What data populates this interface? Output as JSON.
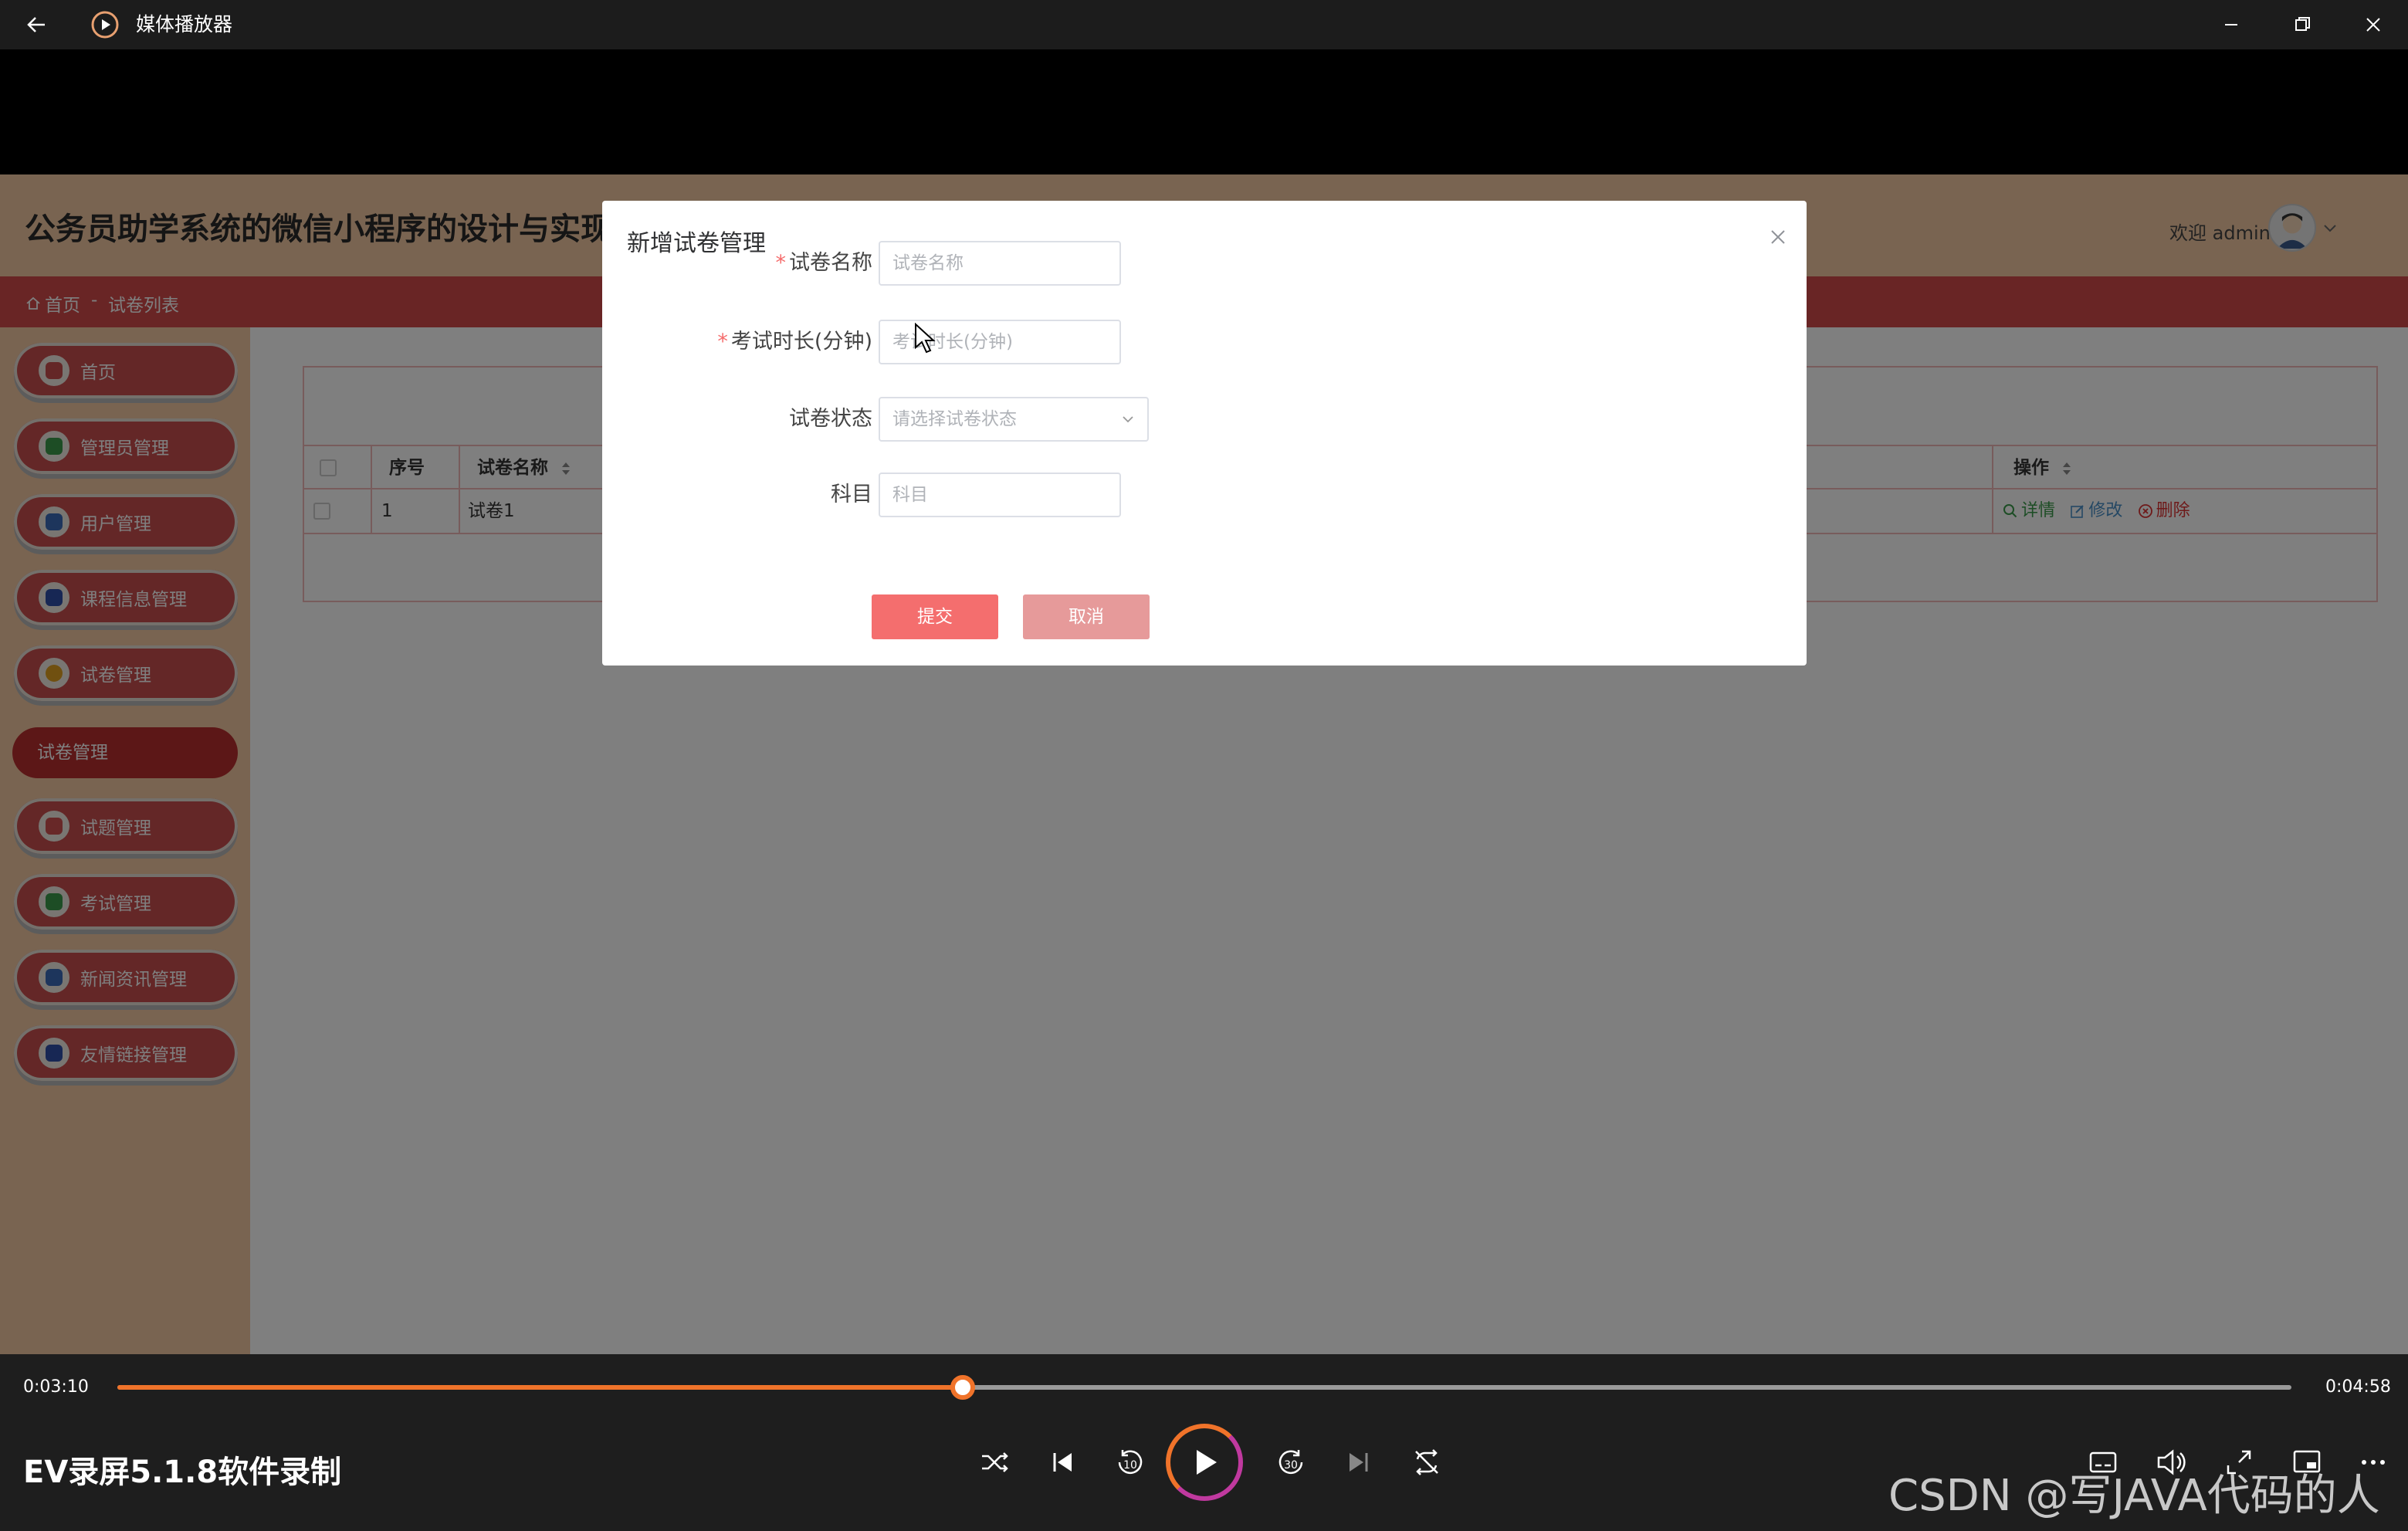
{
  "player": {
    "title": "媒体播放器",
    "time_current": "0:03:10",
    "time_total": "0:04:58",
    "progress": 0.389,
    "track_text": "EV录屏5.1.8软件录制",
    "watermark": "CSDN @写JAVA代码的人",
    "accent_color": "#f0732a"
  },
  "header": {
    "system_title": "公务员助学系统的微信小程序的设计与实现",
    "welcome": "欢迎 admin"
  },
  "breadcrumb": {
    "home": "首页",
    "separator": "-",
    "current": "试卷列表"
  },
  "sidebar": {
    "items": [
      {
        "label": "首页",
        "icon": "home-icon"
      },
      {
        "label": "管理员管理",
        "icon": "admin-icon"
      },
      {
        "label": "用户管理",
        "icon": "user-icon"
      },
      {
        "label": "课程信息管理",
        "icon": "course-icon"
      },
      {
        "label": "试卷管理",
        "icon": "paper-icon"
      },
      {
        "label": "试题管理",
        "icon": "question-icon"
      },
      {
        "label": "考试管理",
        "icon": "exam-icon"
      },
      {
        "label": "新闻资讯管理",
        "icon": "news-icon"
      },
      {
        "label": "友情链接管理",
        "icon": "link-icon"
      }
    ],
    "submenu_active": "试卷管理"
  },
  "table": {
    "columns": [
      "序号",
      "试卷名称",
      "操作"
    ],
    "rows": [
      {
        "index": "1",
        "name": "试卷1"
      }
    ],
    "actions": {
      "detail": "详情",
      "edit": "修改",
      "delete": "删除"
    }
  },
  "dialog": {
    "title": "新增试卷管理",
    "fields": [
      {
        "label": "试卷名称",
        "required": true,
        "placeholder": "试卷名称"
      },
      {
        "label": "考试时长(分钟)",
        "required": true,
        "placeholder": "考试时长(分钟)"
      },
      {
        "label": "试卷状态",
        "required": false,
        "placeholder": "请选择试卷状态"
      },
      {
        "label": "科目",
        "required": false,
        "placeholder": "科目"
      }
    ],
    "submit": "提交",
    "cancel": "取消"
  }
}
